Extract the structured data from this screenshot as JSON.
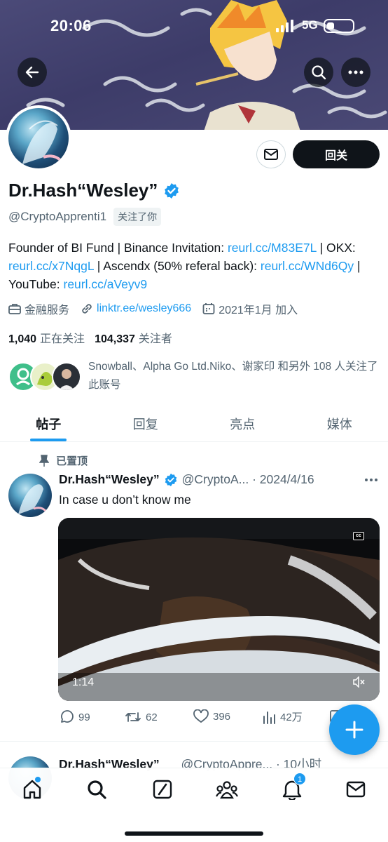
{
  "status_bar": {
    "time": "20:06",
    "network": "5G"
  },
  "profile": {
    "name": "Dr.Hash“Wesley”",
    "handle": "@CryptoApprenti1",
    "follows_you": "关注了你",
    "follow_button": "回关",
    "bio": {
      "t1": "Founder of BI Fund | Binance Invitation: ",
      "l1": "reurl.cc/M83E7L",
      "t2": " | OKX: ",
      "l2": "reurl.cc/x7NqgL",
      "t3": " | Ascendx (50% referal back): ",
      "l3": "reurl.cc/WNd6Qy",
      "t4": " | YouTube: ",
      "l4": "reurl.cc/aVeyv9"
    },
    "category": "金融服务",
    "website": "linktr.ee/wesley666",
    "joined": "2021年1月 加入",
    "following_count": "1,040",
    "following_label": "正在关注",
    "followers_count": "104,337",
    "followers_label": "关注者",
    "followed_by_text": "Snowball、Alpha Go Ltd.Niko、谢家印 和另外 108 人关注了此账号"
  },
  "tabs": [
    "帖子",
    "回复",
    "亮点",
    "媒体"
  ],
  "pinned_post": {
    "pinned_label": "已置顶",
    "author": "Dr.Hash“Wesley”",
    "handle_date": "@CryptoA... · 2024/4/16",
    "text": "In case u don’t know me",
    "video_time": "1:14",
    "cc_label": "cc",
    "replies": "99",
    "reposts": "62",
    "likes": "396",
    "views": "42万"
  },
  "second_post": {
    "author": "Dr.Hash“Wesley”",
    "handle_time": "@CryptoAppre... · 10小时"
  },
  "bottom_nav": {
    "notifications_badge": "1"
  },
  "colors": {
    "accent": "#1d9bf0",
    "text": "#0f1419",
    "muted": "#536471"
  }
}
